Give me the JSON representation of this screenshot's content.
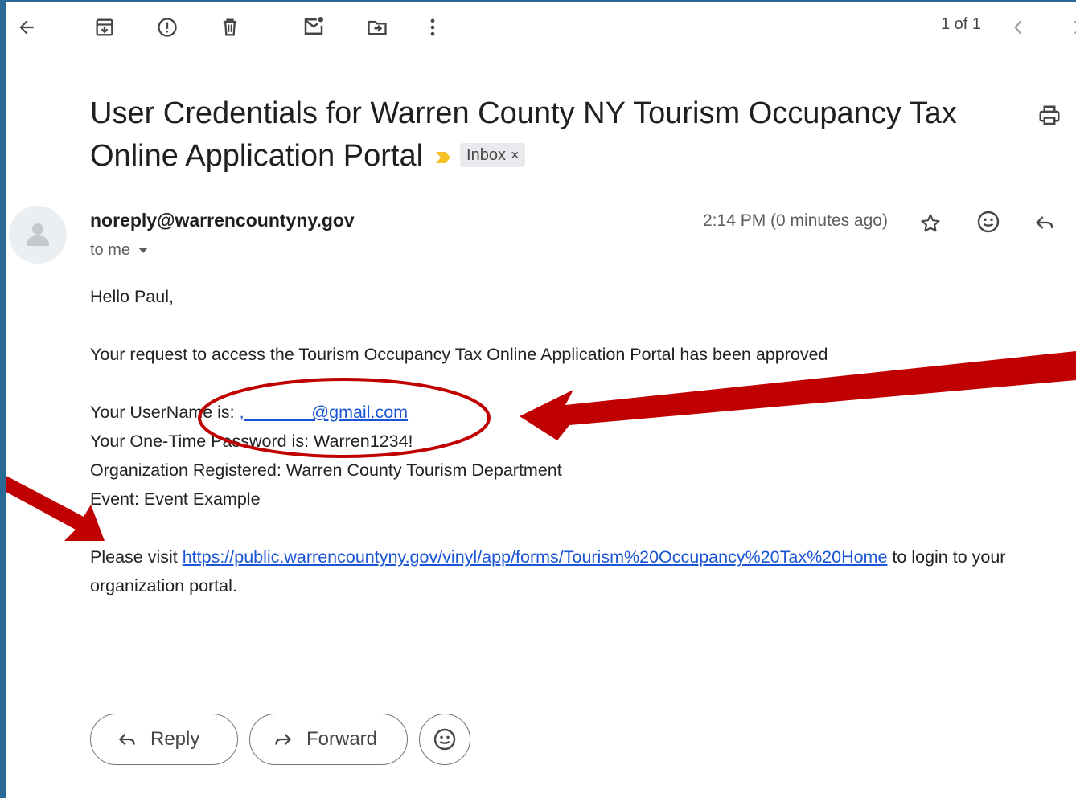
{
  "toolbar": {
    "icons": [
      "back-arrow-icon",
      "archive-icon",
      "report-spam-icon",
      "delete-icon",
      "mark-unread-icon",
      "move-to-icon",
      "more-options-icon"
    ],
    "pager": "1 of 1"
  },
  "email": {
    "subject": "User Credentials for Warren County NY Tourism Occupancy Tax Online Application Portal",
    "label": "Inbox",
    "sender": "noreply@warrencountyny.gov",
    "recipient": "to me",
    "timestamp": "2:14 PM (0 minutes ago)",
    "body": {
      "greeting": "Hello Paul,",
      "approval": "Your request to access the Tourism Occupancy Tax Online Application Portal has been approved",
      "username_label": "Your UserName is: ",
      "username_value": ",_______@gmail.com",
      "password_label": "Your One-Time Password is: ",
      "password_value": "Warren1234!",
      "organization": "Organization Registered: Warren County Tourism Department",
      "event": "Event: Event Example",
      "visit_prefix": "Please visit ",
      "visit_link": "https://public.warrencountyny.gov/vinyl/app/forms/Tourism%20Occupancy%20Tax%20Home",
      "visit_suffix": " to login to your organization portal."
    }
  },
  "actions": {
    "reply_label": "Reply",
    "forward_label": "Forward"
  },
  "colors": {
    "page_border": "#2a6a96",
    "annotation_red": "#c00000",
    "link": "#1a55d6",
    "important_marker": "#f6bf26"
  }
}
